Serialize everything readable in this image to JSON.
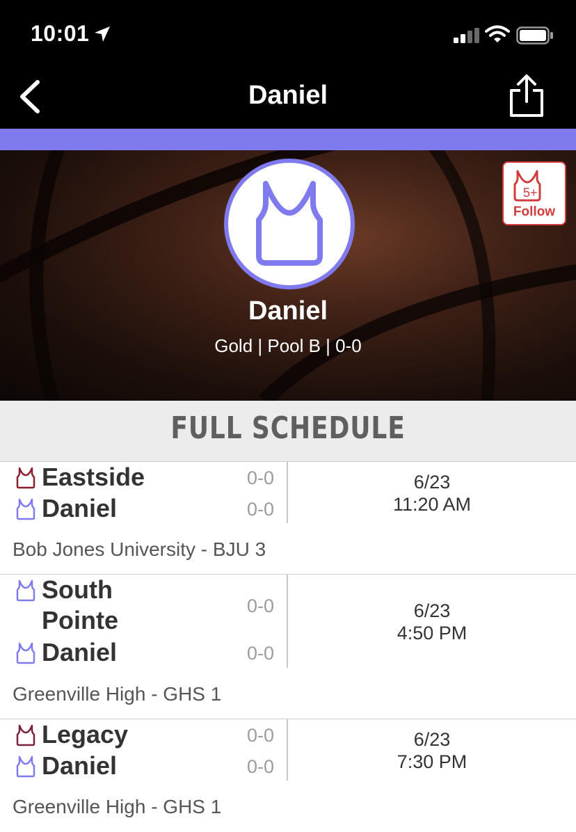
{
  "status_bar": {
    "time": "10:01"
  },
  "nav": {
    "title": "Daniel"
  },
  "team": {
    "name": "Daniel",
    "meta": "Gold | Pool B | 0-0",
    "follow_badge": "5+",
    "follow_label": "Follow"
  },
  "section": {
    "title": "FULL SCHEDULE"
  },
  "colors": {
    "accent": "#7f7bef",
    "follow": "#d23c3c",
    "eastside": "#8b1e2b",
    "legacy": "#7a1f3d"
  },
  "games": [
    {
      "team1": {
        "name": "Eastside",
        "score": "0-0",
        "icon": "jersey-icon"
      },
      "team2": {
        "name": "Daniel",
        "score": "0-0",
        "icon": "jersey-icon"
      },
      "date": "6/23",
      "time": "11:20 AM",
      "venue": "Bob Jones University - BJU 3"
    },
    {
      "team1": {
        "name": "South Pointe",
        "name_line1": "South",
        "name_line2": "Pointe",
        "score": "0-0",
        "icon": "jersey-icon"
      },
      "team2": {
        "name": "Daniel",
        "score": "0-0",
        "icon": "jersey-icon"
      },
      "date": "6/23",
      "time": "4:50 PM",
      "venue": "Greenville High - GHS 1"
    },
    {
      "team1": {
        "name": "Legacy",
        "score": "0-0",
        "icon": "jersey-icon"
      },
      "team2": {
        "name": "Daniel",
        "score": "0-0",
        "icon": "jersey-icon"
      },
      "date": "6/23",
      "time": "7:30 PM",
      "venue": "Greenville High - GHS 1"
    }
  ]
}
